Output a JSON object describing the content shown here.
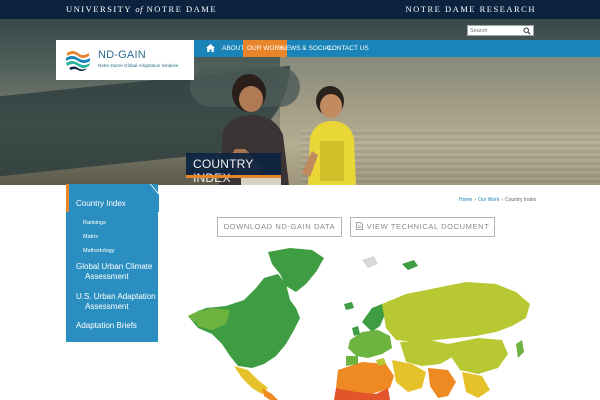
{
  "topbar": {
    "university_prefix": "University",
    "university_of": "of",
    "university_suffix": "Notre Dame",
    "research": "NOTRE DAME RESEARCH"
  },
  "search": {
    "placeholder": "Search",
    "icon": "search-icon"
  },
  "logo": {
    "title": "ND-GAIN",
    "subtitle": "Notre Dame Global Adaptation Initiative"
  },
  "nav": {
    "home_icon": "home-icon",
    "items": [
      {
        "label": "ABOUT"
      },
      {
        "label": "OUR WORK",
        "active": true
      },
      {
        "label": "NEWS & SOCIAL"
      },
      {
        "label": "CONTACT US"
      }
    ],
    "active_color": "#e8842a",
    "bar_color": "#1a84b8"
  },
  "hero": {
    "banner_title": "COUNTRY INDEX"
  },
  "sidebar": {
    "title": "Country Index",
    "sub_items": [
      "Rankings",
      "Matrix",
      "Methodology"
    ],
    "items": [
      {
        "line1": "Global Urban Climate",
        "line2": "Assessment"
      },
      {
        "line1": "U.S. Urban Adaptation",
        "line2": "Assessment"
      },
      {
        "line1": "Adaptation Briefs"
      }
    ]
  },
  "breadcrumb": {
    "home": "Home",
    "our_work": "Our Work",
    "current": "Country Index",
    "separator": "›"
  },
  "buttons": {
    "download": "DOWNLOAD ND-GAIN DATA",
    "view_doc": "VIEW TECHNICAL DOCUMENT",
    "doc_icon": "document-icon"
  },
  "map": {
    "icon": "world-map",
    "colors": [
      "#3e9c42",
      "#6db33f",
      "#b8c832",
      "#e6c22a",
      "#ef8a23",
      "#e2552b",
      "#d8d8d8"
    ]
  }
}
